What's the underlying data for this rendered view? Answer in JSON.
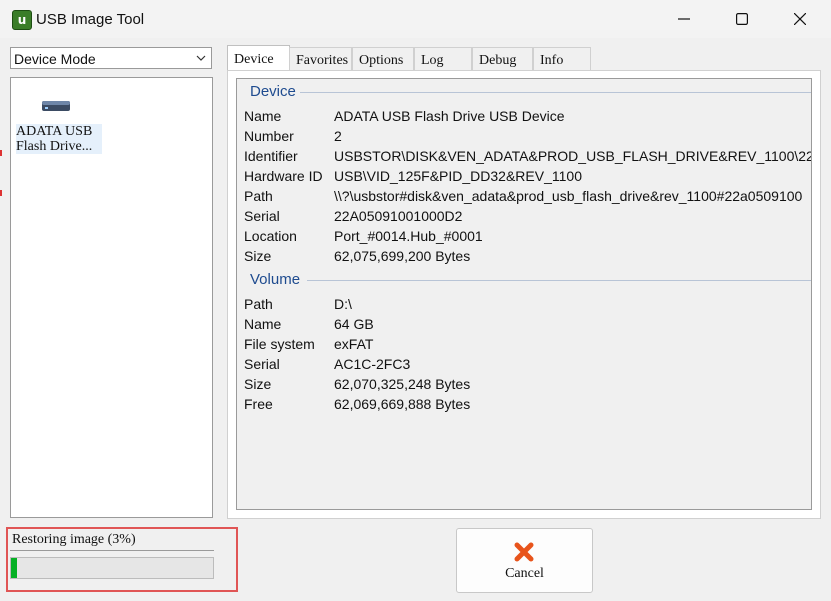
{
  "window": {
    "app_icon_letter": "u",
    "title": "USB Image Tool"
  },
  "left": {
    "mode_select": "Device Mode",
    "devices": [
      {
        "label": "ADATA USB Flash Drive...",
        "icon": "usb-drive-icon"
      }
    ]
  },
  "tabs": [
    {
      "label": "Device",
      "active": true
    },
    {
      "label": "Favorites",
      "active": false
    },
    {
      "label": "Options",
      "active": false
    },
    {
      "label": "Log",
      "active": false
    },
    {
      "label": "Debug",
      "active": false
    },
    {
      "label": "Info",
      "active": false
    }
  ],
  "device_section": {
    "heading": "Device",
    "rows": [
      {
        "label": "Name",
        "value": "ADATA USB Flash Drive USB Device"
      },
      {
        "label": "Number",
        "value": "2"
      },
      {
        "label": "Identifier",
        "value": "USBSTOR\\DISK&VEN_ADATA&PROD_USB_FLASH_DRIVE&REV_1100\\22"
      },
      {
        "label": "Hardware ID",
        "value": "USB\\VID_125F&PID_DD32&REV_1100"
      },
      {
        "label": "Path",
        "value": "\\\\?\\usbstor#disk&ven_adata&prod_usb_flash_drive&rev_1100#22a0509100"
      },
      {
        "label": "Serial",
        "value": "22A05091001000D2"
      },
      {
        "label": "Location",
        "value": "Port_#0014.Hub_#0001"
      },
      {
        "label": "Size",
        "value": "62,075,699,200 Bytes"
      }
    ]
  },
  "volume_section": {
    "heading": "Volume",
    "rows": [
      {
        "label": "Path",
        "value": "D:\\"
      },
      {
        "label": "Name",
        "value": "64 GB"
      },
      {
        "label": "File system",
        "value": "exFAT"
      },
      {
        "label": "Serial",
        "value": "AC1C-2FC3"
      },
      {
        "label": "Size",
        "value": "62,070,325,248 Bytes"
      },
      {
        "label": "Free",
        "value": "62,069,669,888 Bytes"
      }
    ]
  },
  "status": {
    "text": "Restoring image (3%)",
    "progress_percent": 3
  },
  "cancel_button": {
    "label": "Cancel"
  },
  "colors": {
    "progress": "#06b025",
    "section_heading": "#1e4b8f",
    "highlight_border": "#e05555"
  }
}
